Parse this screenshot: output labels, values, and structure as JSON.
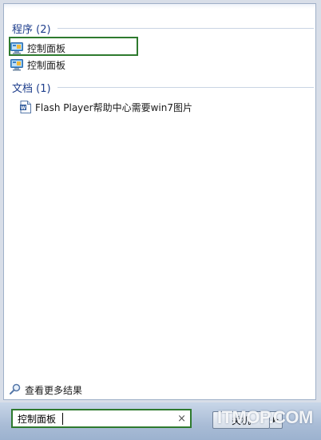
{
  "sections": {
    "programs": {
      "title": "程序 (2)",
      "items": [
        {
          "label": "控制面板",
          "icon": "control-panel-icon"
        },
        {
          "label": "控制面板",
          "icon": "control-panel-icon"
        }
      ]
    },
    "documents": {
      "title": "文档 (1)",
      "items": [
        {
          "label": "Flash Player帮助中心需要win7图片",
          "icon": "word-document-icon"
        }
      ]
    }
  },
  "see_more": {
    "label": "查看更多结果",
    "icon": "search-icon"
  },
  "search": {
    "value": "控制面板",
    "clear_icon": "×"
  },
  "shutdown": {
    "label": "关机",
    "arrow": "▶"
  },
  "watermark": {
    "text": "ITMOP.COM"
  },
  "colors": {
    "highlight": "#2e7a2e",
    "header_text": "#1e3e8c",
    "panel_border": "#9fb0c8"
  }
}
